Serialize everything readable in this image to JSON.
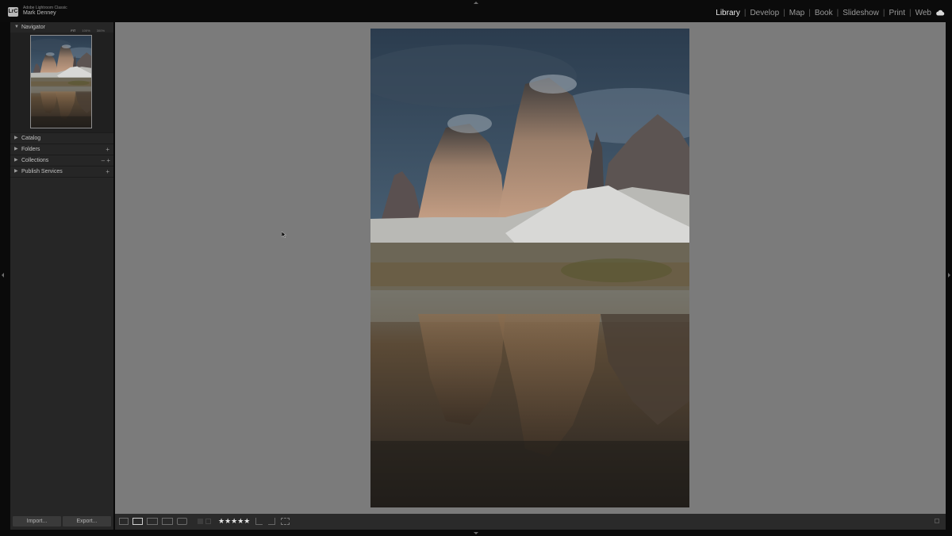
{
  "app": {
    "logo_text": "LrC",
    "name": "Adobe Lightroom Classic",
    "user": "Mark Denney"
  },
  "modules": [
    {
      "label": "Library",
      "active": true
    },
    {
      "label": "Develop",
      "active": false
    },
    {
      "label": "Map",
      "active": false
    },
    {
      "label": "Book",
      "active": false
    },
    {
      "label": "Slideshow",
      "active": false
    },
    {
      "label": "Print",
      "active": false
    },
    {
      "label": "Web",
      "active": false
    }
  ],
  "navigator": {
    "title": "Navigator",
    "zoom_options": [
      "FIT",
      "100%",
      "300%",
      ""
    ],
    "zoom_selected": "FIT"
  },
  "panels": [
    {
      "label": "Catalog",
      "actions": ""
    },
    {
      "label": "Folders",
      "actions": "+"
    },
    {
      "label": "Collections",
      "actions": "– +"
    },
    {
      "label": "Publish Services",
      "actions": "+"
    }
  ],
  "buttons": {
    "import": "Import...",
    "export": "Export..."
  },
  "toolbar": {
    "rating": 5,
    "stars": "★★★★★"
  },
  "colors": {
    "accent_active": "#ececec",
    "panel_bg": "#262626",
    "canvas_bg": "#7b7b7b"
  }
}
